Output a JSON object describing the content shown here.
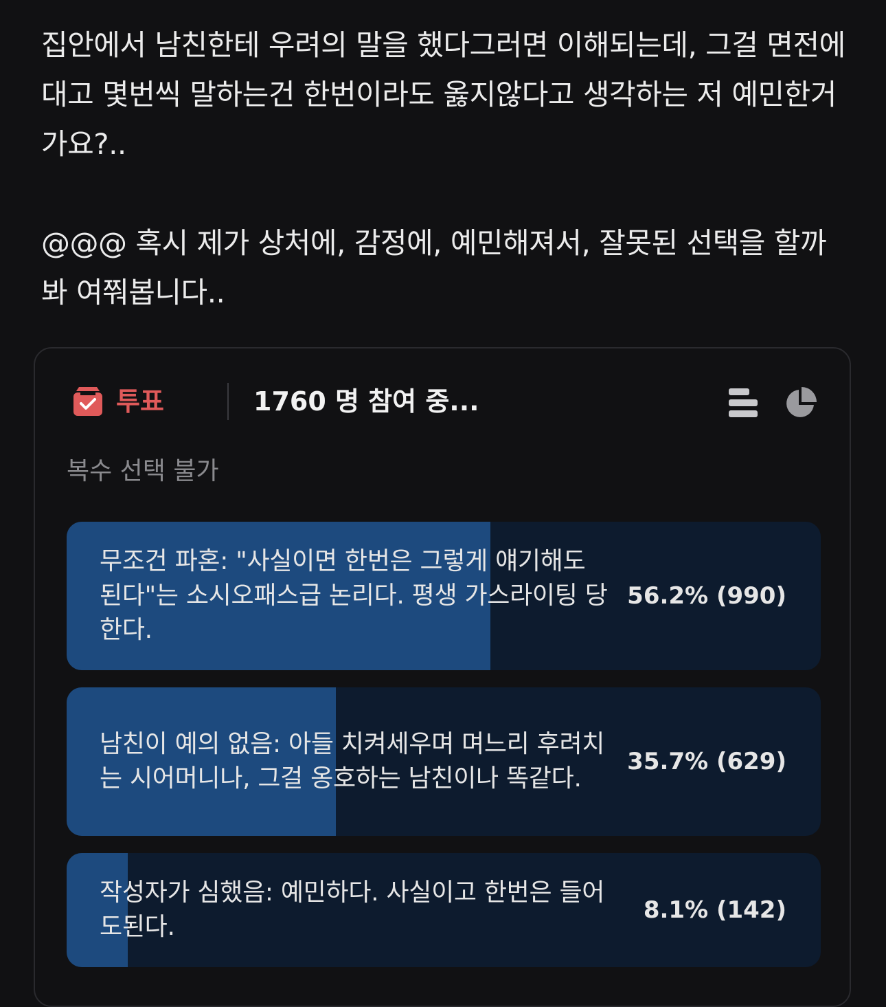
{
  "post": {
    "paragraphs": [
      "집안에서 남친한테 우려의 말을 했다그러면 이해되는데, 그걸 면전에 대고 몇번씩 말하는건 한번이라도 옳지않다고 생각하는 저 예민한거가요?..",
      "@@@ 혹시 제가 상처에, 감정에, 예민해져서, 잘못된 선택을 할까봐 여쭤봅니다.."
    ]
  },
  "poll": {
    "label": "투표",
    "participants": "1760 명 참여 중...",
    "note": "복수 선택 불가",
    "accent_color": "#e05a5a",
    "fill_color": "#1d4a7e",
    "track_color": "#0d1b2e",
    "icons": {
      "vote": "ballot-box-icon",
      "bar_view": "bar-chart-icon",
      "pie_view": "pie-chart-icon"
    },
    "options": [
      {
        "text": "무조건 파혼: \"사실이면 한번은 그렇게 얘기해도 된다\"는 소시오패스급 논리다. 평생 가스라이팅 당한다.",
        "result": "56.2% (990)",
        "percent": 56.2,
        "votes": 990
      },
      {
        "text": "남친이 예의 없음: 아들 치켜세우며 며느리 후려치는 시어머니나, 그걸 옹호하는 남친이나 똑같다.",
        "result": "35.7% (629)",
        "percent": 35.7,
        "votes": 629
      },
      {
        "text": "작성자가 심했음: 예민하다. 사실이고 한번은 들어도된다.",
        "result": "8.1% (142)",
        "percent": 8.1,
        "votes": 142
      }
    ]
  }
}
